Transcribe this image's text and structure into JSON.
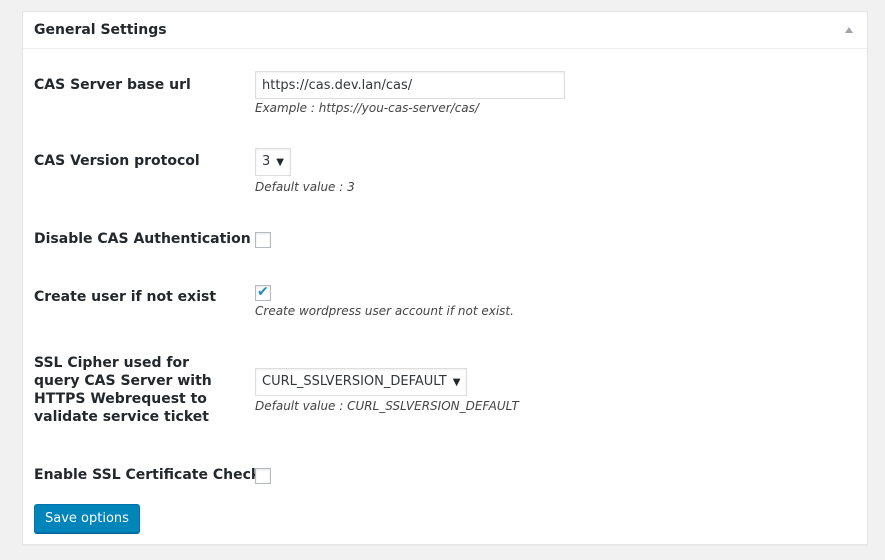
{
  "panel": {
    "title": "General Settings"
  },
  "fields": {
    "cas_server_url": {
      "label": "CAS Server base url",
      "value": "https://cas.dev.lan/cas/",
      "description": "Example : https://you-cas-server/cas/"
    },
    "cas_version": {
      "label": "CAS Version protocol",
      "selected": "3",
      "description": "Default value : 3"
    },
    "disable_cas_auth": {
      "label": "Disable CAS Authentication",
      "checked": false
    },
    "create_user": {
      "label": "Create user if not exist",
      "checked": true,
      "description": "Create wordpress user account if not exist."
    },
    "ssl_cipher": {
      "label": "SSL Cipher used for query CAS Server with HTTPS Webrequest to validate service ticket",
      "selected": "CURL_SSLVERSION_DEFAULT",
      "description": "Default value : CURL_SSLVERSION_DEFAULT"
    },
    "ssl_cert_check": {
      "label": "Enable SSL Certificate Check",
      "checked": false
    }
  },
  "actions": {
    "save_label": "Save options"
  },
  "icons": {
    "toggle": "caret-up-icon",
    "select_arrow": "caret-down-icon",
    "check": "checkmark-icon"
  },
  "colors": {
    "primary_button": "#0085ba",
    "checkmark": "#1e8cbe",
    "page_background": "#f1f1f1"
  }
}
